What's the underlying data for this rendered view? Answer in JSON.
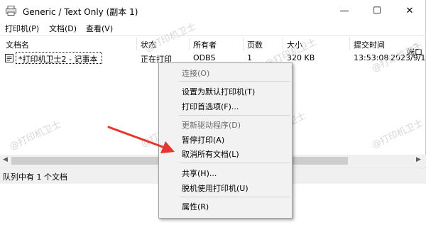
{
  "window": {
    "title": "Generic / Text Only (副本 1)",
    "controls": {
      "minimize": "—",
      "maximize": "☐",
      "close": "✕"
    }
  },
  "menubar": [
    {
      "label": "打印机(P)"
    },
    {
      "label": "文档(D)"
    },
    {
      "label": "查看(V)"
    }
  ],
  "table": {
    "columns": [
      "文档名",
      "状态",
      "所有者",
      "页数",
      "大小",
      "提交时间",
      "端口"
    ],
    "rows": [
      {
        "name": "*打印机卫士2 - 记事本",
        "status": "正在打印",
        "owner": "ODBS",
        "pages": "1",
        "size": "320 KB",
        "time": "13:53:08",
        "date": "2023/9/1"
      }
    ]
  },
  "statusbar": {
    "text": "队列中有 1 个文档"
  },
  "context_menu": {
    "items": [
      {
        "label": "连接(O)",
        "disabled": true
      },
      {
        "label": "设置为默认打印机(T)",
        "disabled": false
      },
      {
        "label": "打印首选项(F)...",
        "disabled": false
      },
      {
        "label": "更新驱动程序(D)",
        "disabled": true
      },
      {
        "label": "暂停打印(A)",
        "disabled": false
      },
      {
        "label": "取消所有文档(L)",
        "disabled": false
      },
      {
        "label": "共享(H)...",
        "disabled": false
      },
      {
        "label": "脱机使用打印机(U)",
        "disabled": false
      },
      {
        "label": "属性(R)",
        "disabled": false
      }
    ]
  },
  "watermark": {
    "text": "@打印机卫士"
  },
  "colors": {
    "arrow": "#e8342c",
    "statusbar": "#f0f0f0",
    "menu_bg": "#f2f2f2"
  }
}
